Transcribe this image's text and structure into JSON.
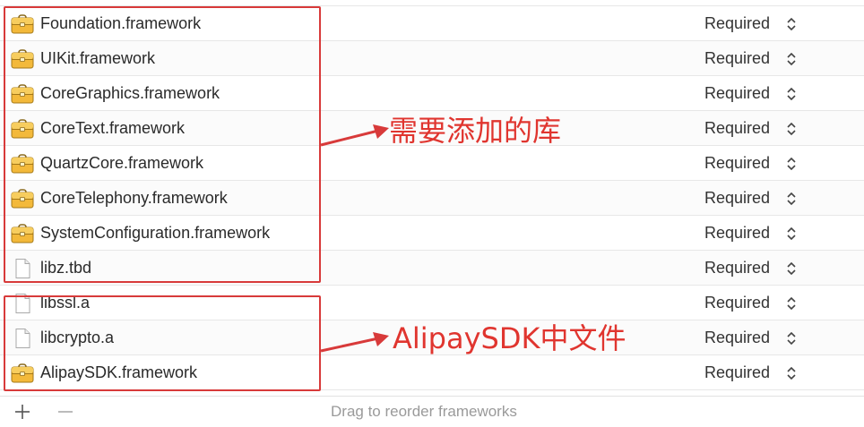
{
  "frameworks": [
    {
      "name": "Foundation.framework",
      "status": "Required",
      "icon": "framework-briefcase-icon"
    },
    {
      "name": "UIKit.framework",
      "status": "Required",
      "icon": "framework-briefcase-icon"
    },
    {
      "name": "CoreGraphics.framework",
      "status": "Required",
      "icon": "framework-briefcase-icon"
    },
    {
      "name": "CoreText.framework",
      "status": "Required",
      "icon": "framework-briefcase-icon"
    },
    {
      "name": "QuartzCore.framework",
      "status": "Required",
      "icon": "framework-briefcase-icon"
    },
    {
      "name": "CoreTelephony.framework",
      "status": "Required",
      "icon": "framework-briefcase-icon"
    },
    {
      "name": "SystemConfiguration.framework",
      "status": "Required",
      "icon": "framework-briefcase-icon"
    },
    {
      "name": "libz.tbd",
      "status": "Required",
      "icon": "file-icon"
    },
    {
      "name": "libssl.a",
      "status": "Required",
      "icon": "file-icon"
    },
    {
      "name": "libcrypto.a",
      "status": "Required",
      "icon": "file-icon"
    },
    {
      "name": "AlipaySDK.framework",
      "status": "Required",
      "icon": "framework-briefcase-icon"
    }
  ],
  "annotations": {
    "required_libs": "需要添加的库",
    "alipay_files": "AlipaySDK中文件"
  },
  "footer": {
    "add_icon": "plus-icon",
    "remove_icon": "minus-icon",
    "hint": "Drag to reorder frameworks"
  },
  "colors": {
    "annotation_red": "#d83a3a",
    "folder_yellow": "#f3b93a"
  }
}
